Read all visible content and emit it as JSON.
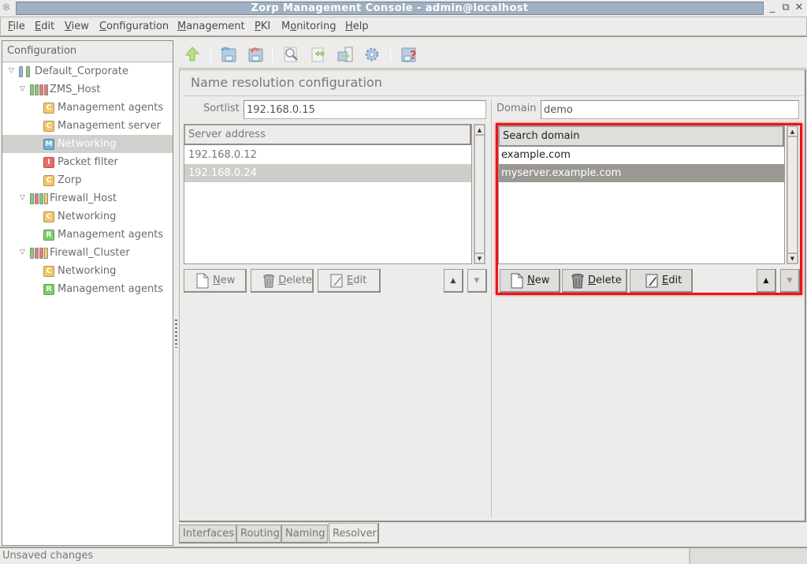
{
  "window": {
    "title": "Zorp Management Console - admin@localhost",
    "icons": {
      "app": "snowflake-app-icon",
      "minimize": "minimize-icon",
      "maximize": "restore-icon",
      "close": "close-icon"
    }
  },
  "menubar": [
    {
      "label": "File",
      "mnemonic": "F"
    },
    {
      "label": "Edit",
      "mnemonic": "E"
    },
    {
      "label": "View",
      "mnemonic": "V"
    },
    {
      "label": "Configuration",
      "mnemonic": "C"
    },
    {
      "label": "Management",
      "mnemonic": "M"
    },
    {
      "label": "PKI",
      "mnemonic": "P"
    },
    {
      "label": "Monitoring",
      "mnemonic": "o"
    },
    {
      "label": "Help",
      "mnemonic": "H"
    }
  ],
  "tree": {
    "header": "Configuration",
    "items": [
      {
        "label": "Default_Corporate",
        "level": 0,
        "kind": "site",
        "expanded": true,
        "bars": [
          "#8fb8e0",
          "#7ed46c"
        ]
      },
      {
        "label": "ZMS_Host",
        "level": 1,
        "kind": "host",
        "expanded": true,
        "bars": [
          "#7ed46c",
          "#7ed46c",
          "#ef7a72",
          "#ef7a72"
        ]
      },
      {
        "label": "Management agents",
        "level": 2,
        "kind": "component",
        "badge": "C",
        "badge_color": "#f2c76a",
        "selected": false
      },
      {
        "label": "Management server",
        "level": 2,
        "kind": "component",
        "badge": "C",
        "badge_color": "#f2c76a",
        "selected": false
      },
      {
        "label": "Networking",
        "level": 2,
        "kind": "component",
        "badge": "M",
        "badge_color": "#6fb2d8",
        "selected": true
      },
      {
        "label": "Packet filter",
        "level": 2,
        "kind": "component",
        "badge": "I",
        "badge_color": "#e96c66",
        "selected": false
      },
      {
        "label": "Zorp",
        "level": 2,
        "kind": "component",
        "badge": "C",
        "badge_color": "#f2c76a",
        "selected": false
      },
      {
        "label": "Firewall_Host",
        "level": 1,
        "kind": "host",
        "expanded": true,
        "bars": [
          "#7ed46c",
          "#ef7a72",
          "#7ed46c",
          "#f2d55a"
        ]
      },
      {
        "label": "Networking",
        "level": 2,
        "kind": "component",
        "badge": "C",
        "badge_color": "#f2c76a",
        "selected": false
      },
      {
        "label": "Management agents",
        "level": 2,
        "kind": "component",
        "badge": "R",
        "badge_color": "#7ccf6a",
        "selected": false
      },
      {
        "label": "Firewall_Cluster",
        "level": 1,
        "kind": "host",
        "expanded": true,
        "bars": [
          "#7ed46c",
          "#ef7a72",
          "#ef7a72",
          "#f2d55a"
        ]
      },
      {
        "label": "Networking",
        "level": 2,
        "kind": "component",
        "badge": "C",
        "badge_color": "#f2c76a",
        "selected": false
      },
      {
        "label": "Management agents",
        "level": 2,
        "kind": "component",
        "badge": "R",
        "badge_color": "#7ccf6a",
        "selected": false
      }
    ]
  },
  "toolbar": {
    "buttons": [
      {
        "name": "go-up-button",
        "icon": "up-arrow-icon"
      },
      {
        "name": "commit-button",
        "icon": "commit-disk-icon"
      },
      {
        "name": "revert-button",
        "icon": "revert-disk-icon"
      },
      {
        "name": "search-button",
        "icon": "magnifier-icon"
      },
      {
        "name": "compare-button",
        "icon": "document-compare-icon"
      },
      {
        "name": "upload-button",
        "icon": "upload-config-icon"
      },
      {
        "name": "settings-button",
        "icon": "gear-icon"
      },
      {
        "name": "help-button",
        "icon": "disk-help-icon"
      }
    ]
  },
  "main": {
    "section_title": "Name resolution configuration",
    "sortlist": {
      "label": "Sortlist",
      "value": "192.168.0.15"
    },
    "domain": {
      "label": "Domain",
      "value": "demo"
    },
    "server_list": {
      "header": "Server address",
      "rows": [
        {
          "value": "192.168.0.12",
          "selected": false
        },
        {
          "value": "192.168.0.24",
          "selected": true
        }
      ],
      "buttons": {
        "new": "New",
        "delete": "Delete",
        "edit": "Edit"
      }
    },
    "search_list": {
      "header": "Search domain",
      "rows": [
        {
          "value": "example.com",
          "selected": false
        },
        {
          "value": "myserver.example.com",
          "selected": true
        }
      ],
      "buttons": {
        "new": "New",
        "delete": "Delete",
        "edit": "Edit"
      },
      "highlight_color": "#e8151b"
    },
    "tabs": [
      {
        "label": "Interfaces",
        "active": false
      },
      {
        "label": "Routing",
        "active": false
      },
      {
        "label": "Naming",
        "active": false
      },
      {
        "label": "Resolver",
        "active": true
      }
    ]
  },
  "status": {
    "text": "Unsaved changes"
  }
}
